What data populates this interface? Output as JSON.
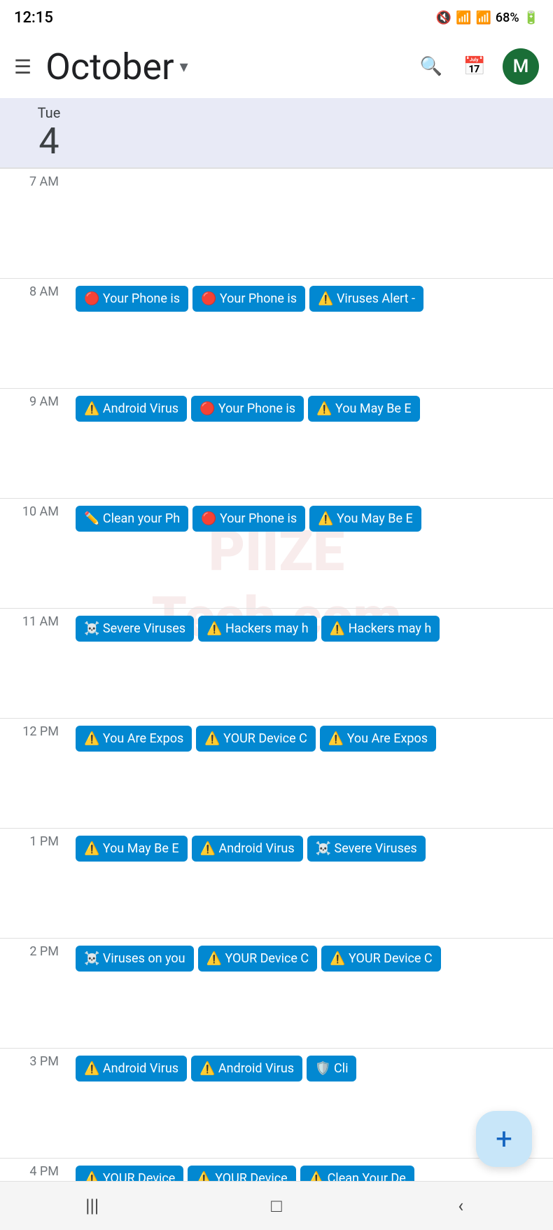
{
  "statusBar": {
    "time": "12:15",
    "battery": "68%",
    "icons": [
      "🔇",
      "📶",
      "📶",
      "🔋"
    ]
  },
  "header": {
    "menuIcon": "☰",
    "monthLabel": "October",
    "dropdownArrow": "▾",
    "searchIcon": "🔍",
    "calendarIcon": "📅",
    "avatarLabel": "M"
  },
  "dateHeader": {
    "dayName": "Tue",
    "dayNum": "4"
  },
  "timeSlots": [
    {
      "label": "7 AM",
      "events": []
    },
    {
      "label": "8 AM",
      "events": [
        {
          "icon": "🔴",
          "text": "Your Phone is"
        },
        {
          "icon": "🔴",
          "text": "Your Phone is"
        },
        {
          "icon": "⚠️",
          "text": "Viruses Alert -"
        }
      ]
    },
    {
      "label": "9 AM",
      "events": [
        {
          "icon": "⚠️",
          "text": "Android Virus"
        },
        {
          "icon": "🔴",
          "text": "Your Phone is"
        },
        {
          "icon": "⚠️",
          "text": "You May Be E"
        }
      ]
    },
    {
      "label": "10 AM",
      "events": [
        {
          "icon": "✏️",
          "text": "Clean your Ph"
        },
        {
          "icon": "🔴",
          "text": "Your Phone is"
        },
        {
          "icon": "⚠️",
          "text": "You May Be E"
        }
      ]
    },
    {
      "label": "11 AM",
      "events": [
        {
          "icon": "☠️",
          "text": "Severe Viruses"
        },
        {
          "icon": "⚠️",
          "text": "Hackers may h"
        },
        {
          "icon": "⚠️",
          "text": "Hackers may h"
        }
      ]
    },
    {
      "label": "12 PM",
      "events": [
        {
          "icon": "⚠️",
          "text": "You Are Expos"
        },
        {
          "icon": "⚠️",
          "text": "YOUR Device C"
        },
        {
          "icon": "⚠️",
          "text": "You Are Expos"
        }
      ]
    },
    {
      "label": "1 PM",
      "events": [
        {
          "icon": "⚠️",
          "text": "You May Be E"
        },
        {
          "icon": "⚠️",
          "text": "Android Virus"
        },
        {
          "icon": "☠️",
          "text": "Severe Viruses"
        }
      ]
    },
    {
      "label": "2 PM",
      "events": [
        {
          "icon": "☠️",
          "text": "Viruses on you"
        },
        {
          "icon": "⚠️",
          "text": "YOUR Device C"
        },
        {
          "icon": "⚠️",
          "text": "YOUR Device C"
        }
      ]
    },
    {
      "label": "3 PM",
      "events": [
        {
          "icon": "⚠️",
          "text": "Android Virus"
        },
        {
          "icon": "⚠️",
          "text": "Android Virus"
        },
        {
          "icon": "🛡️",
          "text": "Cli"
        }
      ]
    }
  ],
  "partialRow": {
    "label": "4 PM",
    "events": [
      {
        "icon": "⚠️",
        "text": "YOUR Device"
      },
      {
        "icon": "⚠️",
        "text": "YOUR Device"
      },
      {
        "icon": "⚠️",
        "text": "Clean Your De"
      }
    ]
  },
  "fab": {
    "icon": "+"
  },
  "bottomNav": {
    "items": [
      "|||",
      "□",
      "‹"
    ]
  }
}
